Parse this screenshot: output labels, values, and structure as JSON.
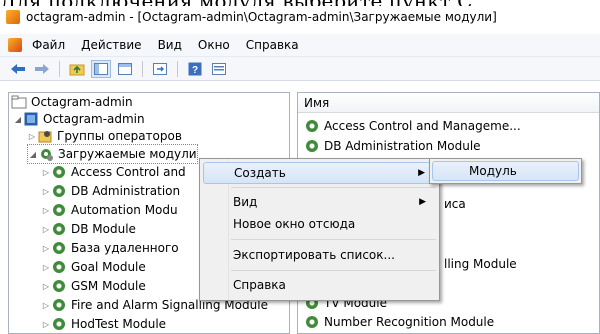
{
  "caption_overlay": "Для подключения модуля выберите пункт С",
  "window": {
    "title": "octagram-admin - [Octagram-admin\\Octagram-admin\\Загружаемые модули]"
  },
  "menubar": {
    "items": [
      "Файл",
      "Действие",
      "Вид",
      "Окно",
      "Справка"
    ]
  },
  "toolbar": {
    "buttons": [
      "back-arrow-icon",
      "forward-arrow-icon",
      "folder-up-icon",
      "show-hide-tree-icon",
      "export-list-icon",
      "help-icon",
      "properties-icon"
    ]
  },
  "tree": {
    "root": "Octagram-admin",
    "server": "Octagram-admin",
    "groups": "Группы операторов",
    "modules_folder": "Загружаемые модули",
    "children": [
      "Access Control and",
      "DB Administration",
      "Automation Modu",
      "DB Module",
      "База удаленного",
      "Goal Module",
      "GSM Module",
      "Fire and Alarm Signalling Module",
      "HodTest Module"
    ]
  },
  "list": {
    "column_header": "Имя",
    "items": [
      "Access Control and Manageme...",
      "DB Administration Module",
      "иса",
      "lling Module",
      "TV Module",
      "Number Recognition Module"
    ]
  },
  "context_menu": {
    "items": [
      "Создать",
      "Вид",
      "Новое окно отсюда",
      "Экспортировать список...",
      "Справка"
    ]
  },
  "submenu": {
    "items": [
      "Модуль"
    ]
  },
  "colors": {
    "accent": "#3f8b3a",
    "highlight": "#d6e5f7",
    "highlight_border": "#a8c6ec"
  }
}
